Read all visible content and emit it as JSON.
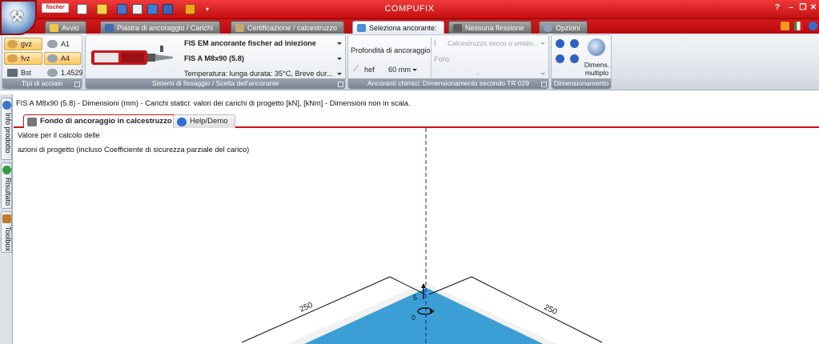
{
  "app": {
    "title": "COMPUFIX",
    "brand": "fischer"
  },
  "window_controls": [
    "?",
    "–",
    "❐",
    "✕"
  ],
  "ribbon_tabs": [
    {
      "label": "Avvio",
      "active": false
    },
    {
      "label": "Piastra di ancoraggio / Carichi",
      "active": false
    },
    {
      "label": "Certificazione / calcestruzzo",
      "active": false
    },
    {
      "label": "Seleziona ancorante:",
      "active": true
    },
    {
      "label": "Nessuna flessione",
      "active": false
    },
    {
      "label": "Opzioni",
      "active": false
    }
  ],
  "ribbon": {
    "steel": {
      "label": "Tipi di acciaio",
      "buttons": [
        "gvz",
        "A1",
        "fvz",
        "A4",
        "Bst",
        "1.4529"
      ]
    },
    "fixing": {
      "label": "Sistemi di fissaggio / Scelta dell'ancorante",
      "system": "FIS EM ancorante fischer ad iniezione",
      "anchor": "FIS A M8x90 (5.8)",
      "temperature": "Temperatura: lunga durata: 35°C, Breve dur..."
    },
    "chemical": {
      "label": "Ancoranti chimici: Dimensionamento secondo TR 029",
      "depth_title": "Profondità di ancoraggio:",
      "hef_label": "hef",
      "hef_value": "60 mm",
      "concrete": "Calcestruzzo secco o umido...",
      "hole_label": "Foro:",
      "hole_value": "-"
    },
    "dimensioning": {
      "label": "Dimensionamento",
      "button": "Dimens. multiplo"
    }
  },
  "left_tabs": [
    "Info prodotto",
    "Risultato",
    "Toolbox"
  ],
  "info_line": "FIS A M8x90 (5.8) - Dimensioni (mm) - Carichi statici: valori dei carichi di progetto [kN], [kNm] - Dimensioni non in scala.",
  "content_tabs": [
    {
      "label": "Fondo di ancoraggio in calcestruzzo",
      "active": true
    },
    {
      "label": "Help/Demo",
      "active": false
    }
  ],
  "canvas": {
    "note_line1": "Valore per il calcolo delle",
    "note_line2": "azioni di progetto (incluso Coefficiente di sicurezza parziale del carico)",
    "dim_left": "250",
    "dim_right": "250",
    "load_n": "5",
    "load_m": "0"
  },
  "colors": {
    "title_red": "#d0181b",
    "accent_orange": "#ffd58a",
    "concrete_blue": "#3b9fd6",
    "axis_blue": "#1a1aa8"
  }
}
